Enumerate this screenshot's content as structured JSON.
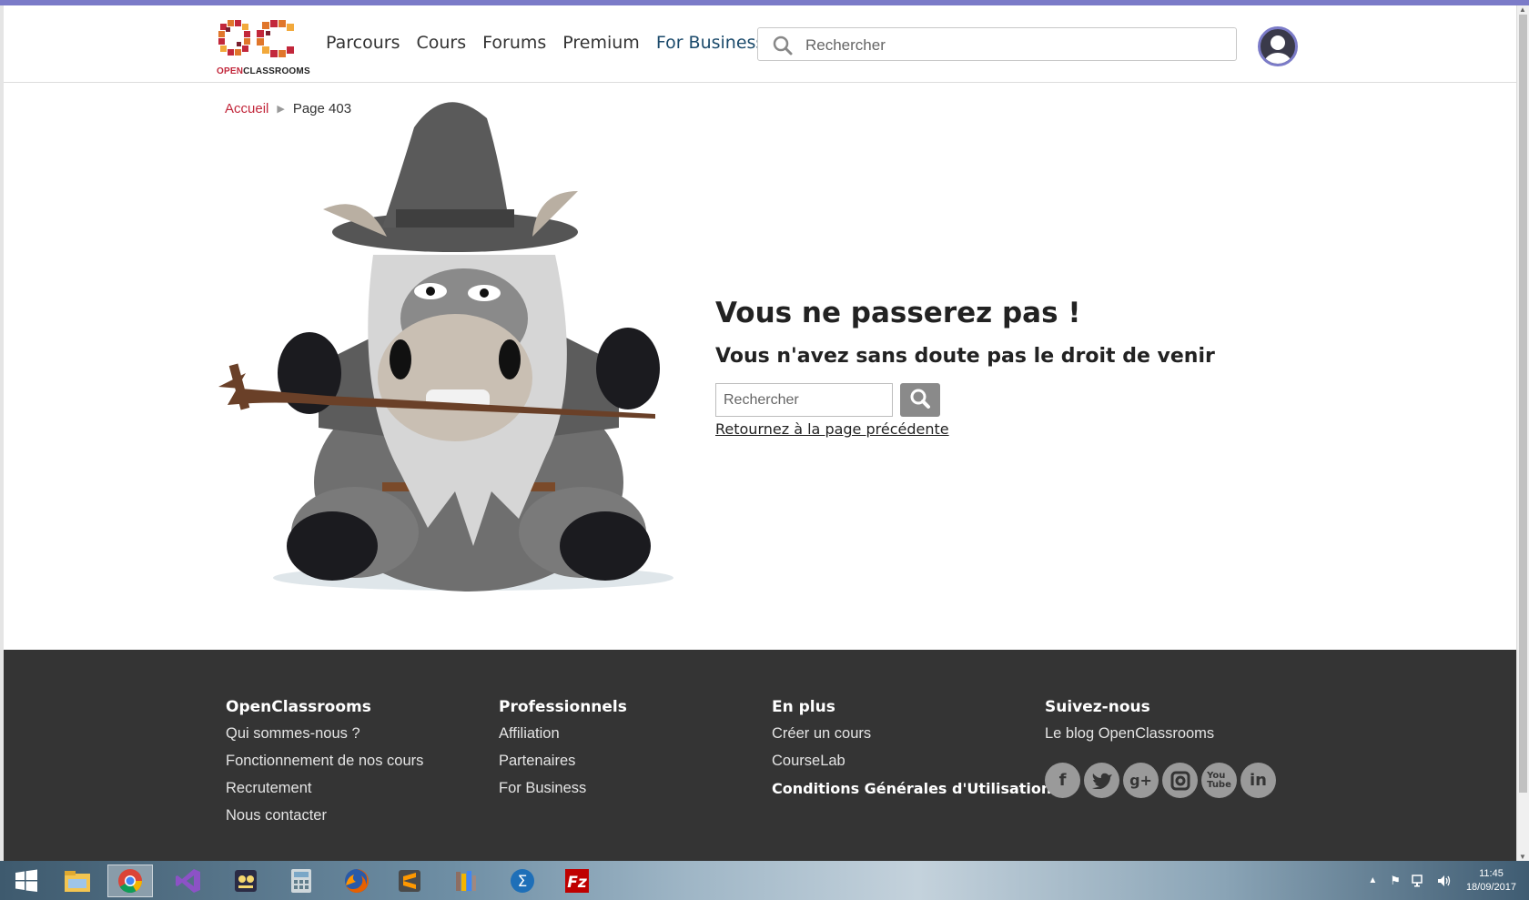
{
  "header": {
    "logo_text_a": "OPEN",
    "logo_text_b": "CLASSROOMS",
    "nav": [
      "Parcours",
      "Cours",
      "Forums",
      "Premium",
      "For Business"
    ],
    "search_placeholder": "Rechercher"
  },
  "breadcrumb": {
    "home": "Accueil",
    "current": "Page 403"
  },
  "error": {
    "title": "Vous ne passerez pas !",
    "subtitle": "Vous n'avez sans doute pas le droit de venir",
    "search_placeholder": "Rechercher",
    "back_link": "Retournez à la page précédente"
  },
  "footer": {
    "col1": {
      "title": "OpenClassrooms",
      "links": [
        "Qui sommes-nous ?",
        "Fonctionnement de nos cours",
        "Recrutement",
        "Nous contacter"
      ]
    },
    "col2": {
      "title": "Professionnels",
      "links": [
        "Affiliation",
        "Partenaires",
        "For Business"
      ]
    },
    "col3": {
      "title": "En plus",
      "links": [
        "Créer un cours",
        "CourseLab",
        "Conditions Générales d'Utilisation"
      ]
    },
    "col4": {
      "title": "Suivez-nous",
      "links": [
        "Le blog OpenClassrooms"
      ]
    },
    "socials": [
      "facebook-icon",
      "twitter-icon",
      "google-plus-icon",
      "instagram-icon",
      "youtube-icon",
      "linkedin-icon"
    ]
  },
  "taskbar": {
    "apps": [
      "windows-start-icon",
      "file-explorer-icon",
      "chrome-icon",
      "visual-studio-icon",
      "media-app-icon",
      "calculator-icon",
      "firefox-icon",
      "sublime-text-icon",
      "library-icon",
      "sigma-app-icon",
      "filezilla-icon"
    ],
    "time": "11:45",
    "date": "18/09/2017"
  },
  "colors": {
    "accent": "#7b7bc8",
    "brand_red": "#c2273b",
    "footer_bg": "#343434"
  }
}
